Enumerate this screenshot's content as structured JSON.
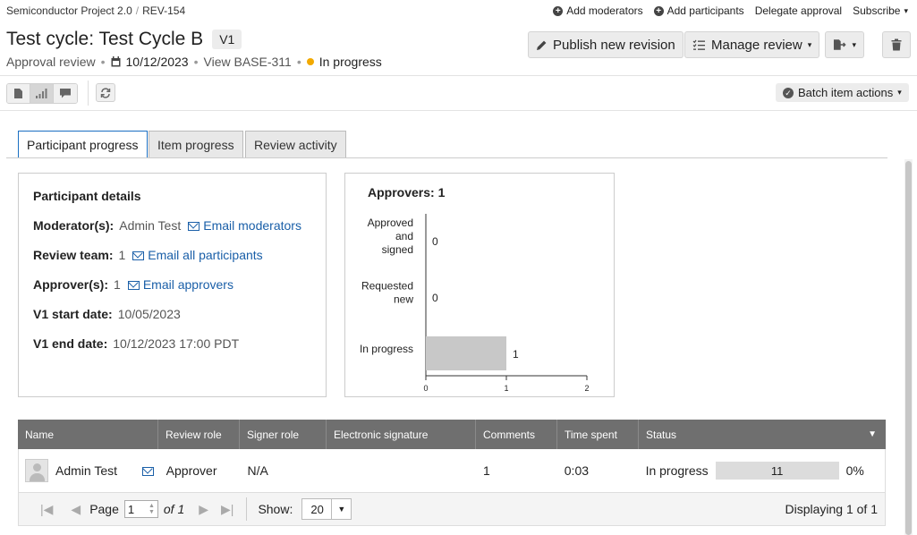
{
  "breadcrumb": {
    "project": "Semiconductor Project 2.0",
    "separator": "/",
    "item": "REV-154"
  },
  "top_actions": {
    "add_moderators": "Add moderators",
    "add_participants": "Add participants",
    "delegate_approval": "Delegate approval",
    "subscribe": "Subscribe"
  },
  "header": {
    "title": "Test cycle: Test Cycle B",
    "version_badge": "V1",
    "review_type": "Approval review",
    "date": "10/12/2023",
    "view_link": "View BASE-311",
    "status": "In progress",
    "status_color": "#f2a900"
  },
  "toolbar": {
    "publish": "Publish new revision",
    "manage": "Manage review",
    "batch": "Batch item actions"
  },
  "tabs": [
    {
      "label": "Participant progress",
      "active": true
    },
    {
      "label": "Item progress",
      "active": false
    },
    {
      "label": "Review activity",
      "active": false
    }
  ],
  "details": {
    "heading": "Participant details",
    "moderators_label": "Moderator(s):",
    "moderators_value": "Admin Test",
    "email_moderators": "Email moderators",
    "team_label": "Review team:",
    "team_value": "1",
    "email_all": "Email all participants",
    "approvers_label": "Approver(s):",
    "approvers_value": "1",
    "email_approvers": "Email approvers",
    "start_label": "V1 start date:",
    "start_value": "10/05/2023",
    "end_label": "V1 end date:",
    "end_value": "10/12/2023 17:00 PDT"
  },
  "chart_data": {
    "type": "bar",
    "orientation": "horizontal",
    "title": "Approvers: 1",
    "categories": [
      [
        "Approved",
        "and",
        "signed"
      ],
      [
        "Requested",
        "new"
      ],
      [
        "In progress"
      ]
    ],
    "values": [
      0,
      0,
      1
    ],
    "xlim": [
      0,
      2
    ],
    "xticks": [
      0,
      1,
      2
    ],
    "bar_color": "#c8c8c8"
  },
  "table": {
    "columns": [
      "Name",
      "Review role",
      "Signer role",
      "Electronic signature",
      "Comments",
      "Time spent",
      "Status"
    ],
    "rows": [
      {
        "name": "Admin Test",
        "review_role": "Approver",
        "signer_role": "N/A",
        "esignature": "",
        "comments": "1",
        "time_spent": "0:03",
        "status": "In progress",
        "progress_label": "11",
        "percent": "0%"
      }
    ]
  },
  "pager": {
    "page_label": "Page",
    "page_value": "1",
    "of_label": "of 1",
    "show_label": "Show:",
    "page_size": "20",
    "displaying": "Displaying 1 of 1"
  }
}
